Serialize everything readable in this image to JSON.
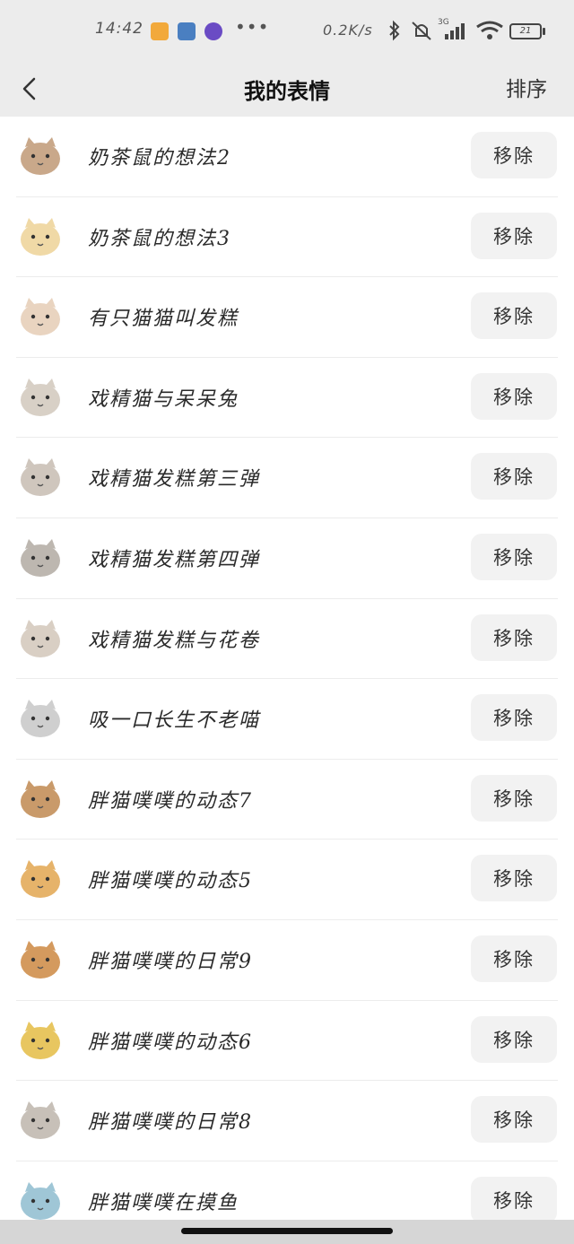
{
  "status_bar": {
    "time": "14:42",
    "net_speed": "0.2K/s",
    "network_type": "3G",
    "battery": "21",
    "dots": "•••",
    "app_icons": [
      {
        "name": "orange-app-icon",
        "color": "#f2a93b"
      },
      {
        "name": "gear-app-icon",
        "color": "#4a7fc1"
      },
      {
        "name": "purple-app-icon",
        "color": "#6a4bc4"
      }
    ]
  },
  "header": {
    "title": "我的表情",
    "sort_label": "排序",
    "back_icon": "chevron-left-icon"
  },
  "stickers": [
    {
      "name": "奶茶鼠的想法2",
      "action": "移除",
      "thumb": "mouse-sticker-icon"
    },
    {
      "name": "奶茶鼠的想法3",
      "action": "移除",
      "thumb": "mouse-sticker-icon"
    },
    {
      "name": "有只猫猫叫发糕",
      "action": "移除",
      "thumb": "cat-sticker-icon"
    },
    {
      "name": "戏精猫与呆呆兔",
      "action": "移除",
      "thumb": "cat-rabbit-sticker-icon"
    },
    {
      "name": "戏精猫发糕第三弹",
      "action": "移除",
      "thumb": "cat-sticker-icon"
    },
    {
      "name": "戏精猫发糕第四弹",
      "action": "移除",
      "thumb": "cat-sticker-icon"
    },
    {
      "name": "戏精猫发糕与花卷",
      "action": "移除",
      "thumb": "cat-sticker-icon"
    },
    {
      "name": "吸一口长生不老喵",
      "action": "移除",
      "thumb": "cat-sticker-icon"
    },
    {
      "name": "胖猫噗噗的动态7",
      "action": "移除",
      "thumb": "cat-sticker-icon"
    },
    {
      "name": "胖猫噗噗的动态5",
      "action": "移除",
      "thumb": "cat-sticker-icon"
    },
    {
      "name": "胖猫噗噗的日常9",
      "action": "移除",
      "thumb": "cat-sticker-icon"
    },
    {
      "name": "胖猫噗噗的动态6",
      "action": "移除",
      "thumb": "cat-sticker-icon"
    },
    {
      "name": "胖猫噗噗的日常8",
      "action": "移除",
      "thumb": "cat-sticker-icon"
    },
    {
      "name": "胖猫噗噗在摸鱼",
      "action": "移除",
      "thumb": "cat-sticker-icon"
    }
  ],
  "colors": {
    "header_bg": "#ececec",
    "row_divider": "#ececec",
    "button_bg": "#f2f2f2"
  }
}
